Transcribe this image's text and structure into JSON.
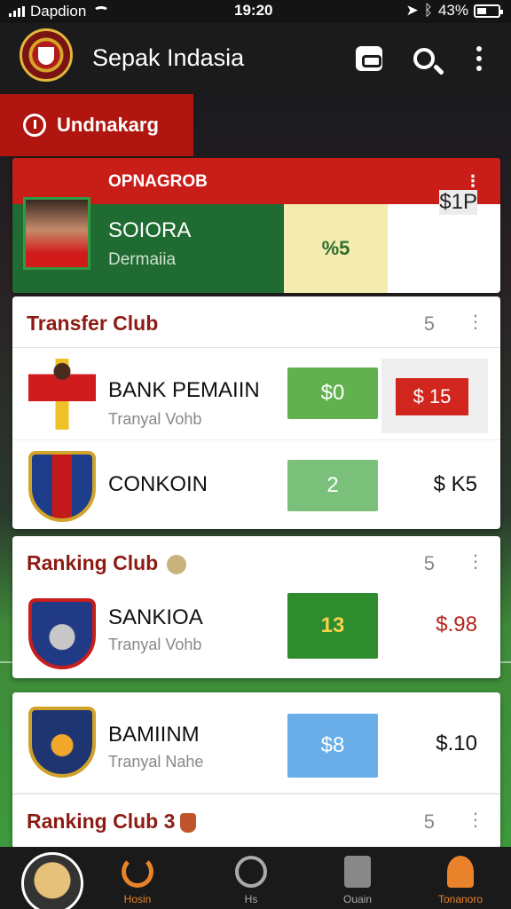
{
  "status_bar": {
    "carrier": "Dapdion",
    "time": "19:20",
    "battery": "43%"
  },
  "app_bar": {
    "title": "Sepak Indasia"
  },
  "tab": {
    "label": "Undnakarg"
  },
  "featured": {
    "header": "OPNAGROB",
    "name": "SOIORA",
    "subtitle": "Dermaiia",
    "score": "%5",
    "price": "$1P"
  },
  "transfer_club": {
    "title": "Transfer Club",
    "count": "5",
    "rows": [
      {
        "name": "BANK PEMAIIN",
        "subtitle": "Tranyal Vohb",
        "chip": "$0",
        "price": "$ 15"
      },
      {
        "name": "CONKOIN",
        "subtitle": "",
        "chip": "2",
        "price": "$ K5"
      }
    ]
  },
  "ranking_club_1": {
    "title": "Ranking Club",
    "count": "5",
    "rows": [
      {
        "name": "SANKIOA",
        "subtitle": "Tranyal Vohb",
        "chip": "13",
        "price": "$.98"
      }
    ]
  },
  "ranking_club_2": {
    "title": "Ranking Club 3",
    "count": "5",
    "rows": [
      {
        "name": "BAMIINM",
        "subtitle": "Tranyal Nahe",
        "chip": "$8",
        "price": "$.10"
      }
    ]
  },
  "bottom_nav": {
    "items": [
      "Hosin",
      "Hs",
      "Ouain",
      "Tonanoro"
    ]
  },
  "colors": {
    "primary_red": "#b0150f",
    "header_red": "#c91d18",
    "featured_green": "#1f6b32",
    "chip_green": "#62b14f",
    "chip_blue": "#69aee8",
    "accent_orange": "#e8832b"
  }
}
